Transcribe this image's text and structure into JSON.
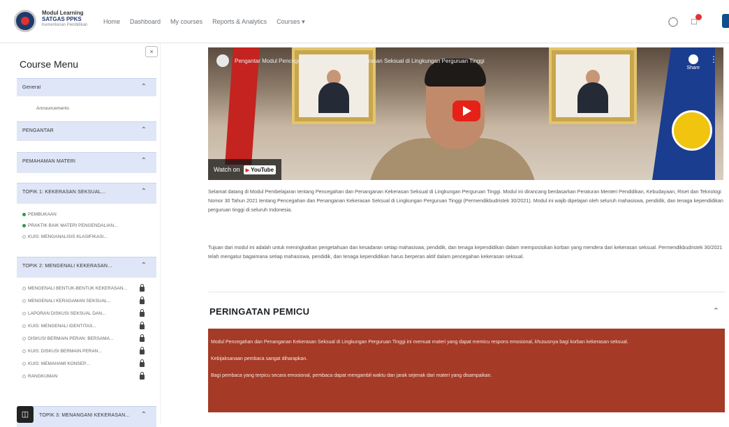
{
  "brand": {
    "line1": "Modul Learning",
    "line2": "SATGAS PPKS",
    "line3": "Kementerian Pendidikan"
  },
  "nav": [
    "Home",
    "Dashboard",
    "My courses",
    "Reports & Analytics",
    "Courses"
  ],
  "sidebar": {
    "title": "Course Menu",
    "close_label": "×",
    "sections": [
      {
        "label": "General",
        "items": [
          {
            "text": "Announcements",
            "status": "none"
          }
        ]
      },
      {
        "label": "PENGANTAR",
        "items": []
      },
      {
        "label": "PEMAHAMAN MATERI",
        "items": []
      },
      {
        "label": "TOPIK 1: KEKERASAN SEKSUAL...",
        "items": [
          {
            "text": "PEMBUKAAN",
            "status": "done"
          },
          {
            "text": "PRAKTIK BAIK MATERI PENGENDALIAN...",
            "status": "done"
          },
          {
            "text": "KUIS: MENGANALISIS KLASIFIKASI...",
            "status": "open"
          }
        ]
      },
      {
        "label": "TOPIK 2: MENGENALI KEKERASAN...",
        "items": [
          {
            "text": "MENGENALI BENTUK-BENTUK KEKERASAN...",
            "status": "locked"
          },
          {
            "text": "MENGENALI KERAGAMAN SEKSUAL...",
            "status": "locked"
          },
          {
            "text": "LAPORAN DISKUSI SEKSUAL DAN...",
            "status": "locked"
          },
          {
            "text": "KUIS: MENGENALI IDENTITAS...",
            "status": "locked"
          },
          {
            "text": "DISKUSI BERMAIN PERAN: BERSAMA...",
            "status": "locked"
          },
          {
            "text": "KUIS: DISKUSI BERMAIN PERAN...",
            "status": "locked"
          },
          {
            "text": "KUIS: MEMAHAMI KONSEP...",
            "status": "locked"
          },
          {
            "text": "RANGKUMAN",
            "status": "locked"
          }
        ]
      },
      {
        "label": "TOPIK 3: MENANGANI KEKERASAN...",
        "items": []
      }
    ]
  },
  "video": {
    "title": "Pengantar Modul Pencegahan dan Penanganan Kekerasan Seksual di Lingkungan Perguruan Tinggi",
    "share_label": "Share",
    "watch_on": "Watch on",
    "youtube": "YouTube"
  },
  "paragraphs": [
    "Selamat datang di Modul Pembelajaran tentang Pencegahan dan Penanganan Kekerasan Seksual di Lingkungan Perguruan Tinggi. Modul ini dirancang berdasarkan Peraturan Menteri Pendidikan, Kebudayaan, Riset dan Teknologi Nomor 30 Tahun 2021 tentang Pencegahan dan Penanganan Kekerasan Seksual di Lingkungan Perguruan Tinggi (Permendikbudristek 30/2021). Modul ini wajib dipelajari oleh seluruh mahasiswa, pendidik, dan tenaga kependidikan perguruan tinggi di seluruh Indonesia.",
    "Tujuan dari modul ini adalah untuk meningkatkan pengetahuan dan kesadaran setiap mahasiswa, pendidik, dan tenaga kependidikan dalam memposisikan korban yang mendera dari kekerasan seksual. Permendikbudristek 30/2021 telah mengatur bagaimana setiap mahasiswa, pendidik, dan tenaga kependidikan harus berperan aktif dalam pencegahan kekerasan seksual."
  ],
  "warning": {
    "title": "PERINGATAN PEMICU",
    "lines": [
      "Modul Pencegahan dan Penanganan Kekerasan Seksual di Lingkungan Perguruan Tinggi ini memuat materi yang dapat memicu respons emosional, khususnya bagi korban kekerasan seksual.",
      "Kebijaksanaan pembaca sangat diharapkan.",
      "Bagi pembaca yang terpicu secara emosional, pembaca dapat mengambil waktu dan jarak sejenak dari materi yang disampaikan."
    ]
  },
  "colors": {
    "sidebar_section": "#dfe6f7",
    "alert_bg": "#a53a26",
    "done_dot": "#2e9b47",
    "youtube_red": "#e62117"
  }
}
